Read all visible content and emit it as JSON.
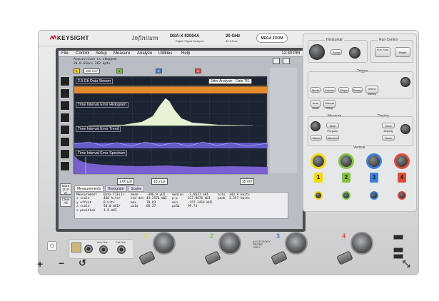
{
  "header": {
    "brand": "KEYSIGHT",
    "family": "Infiniium",
    "model": "DSA-X 92004A",
    "model_sub": "Digital Signal Analyzer",
    "bandwidth": "20 GHz",
    "sample_rate": "80 GSa/s",
    "badge": "MEGA ZOOM"
  },
  "screen": {
    "menu": [
      "File",
      "Control",
      "Setup",
      "Measure",
      "Analyze",
      "Utilities",
      "Help"
    ],
    "clock": "12:30 PM",
    "status_lines": [
      "Acquisition is stopped.",
      "20.0 GSa/s   262 kpts"
    ],
    "channel_scale": "200 mV/",
    "trace_labels": [
      "2.5 Gb Data Stream",
      "Time Interval Error Histogram",
      "Time Interval Error Trend",
      "Time Interval Error Spectrum"
    ],
    "jitter_label": "Jitter Analysis - Data TIE",
    "timebase_scale": "1.00 µs/",
    "timebase_delay": "18.2 µs",
    "trigger_level": "35 mV",
    "tabs": [
      "Measurements",
      "Histogram",
      "Scales"
    ],
    "more_label": "More (2 of 2)",
    "clear_label": "Clear All",
    "measurements": [
      [
        "Measurement",
        "Data TIE(1)",
        "mean",
        "-396.9 µUI",
        "median",
        "-1.8637 mUI",
        "hits",
        "343.9 kbits"
      ],
      [
        "x scale",
        "460 hits/",
        "std dev",
        "43.2576 mUI",
        "p-p",
        "317.9676 mUI",
        "peak",
        "3.357 kbits"
      ],
      [
        "y offset",
        "0 hits",
        "max",
        "78.83",
        "min",
        "-157.2414 mUI",
        "",
        ""
      ],
      [
        "x scale",
        "50.0 mUI/",
        "μ±1σ",
        "68.27",
        "μ±3σ",
        "99.73",
        "",
        ""
      ],
      [
        "x position",
        "1.0 mUI",
        "",
        "",
        "",
        "",
        "",
        ""
      ]
    ]
  },
  "panel": {
    "horizontal": "Horizontal",
    "run_control": "Run Control",
    "zoom": "Zoom",
    "run_stop": "Run Stop",
    "single": "Single",
    "trigger": "Trigger",
    "trigger_buttons": [
      "Mode",
      "Source",
      "Slope",
      "Sweep",
      "Select Sweep"
    ],
    "auto_scale": "Auto Scale",
    "default_setup": "Default Setup",
    "measure": "Measure",
    "display": "Display",
    "marker": "Marker",
    "measure_buttons": [
      "Position",
      "Multi Purpose",
      "Markers",
      "Touch",
      "Intensity",
      "Clear Display",
      "Select"
    ],
    "vertical": "Vertical",
    "channels": [
      "1",
      "2",
      "3",
      "4"
    ]
  },
  "bottom": {
    "aux_out": "Aux Out",
    "cal_out": "Cal Out",
    "inputs": [
      "1",
      "2",
      "3",
      "4"
    ],
    "warning": "ACCESSORY PROBE ONLY"
  },
  "colors": {
    "ch1": "#f5d90a",
    "ch2": "#7fc241",
    "ch3": "#3f7fd6",
    "ch4": "#e24b3a",
    "wave_bg": "#1c2333",
    "data_stream": "#e38a2b",
    "histogram": "#e8f3d6",
    "trend": "#6e63d8",
    "spectrum": "#7a5fd0"
  },
  "icons": {
    "brand_mark": "keysight-wave-icon",
    "power": "power-icon",
    "zoom_in": "plus-icon",
    "zoom_out": "minus-icon",
    "reset": "reset-icon",
    "expand": "expand-icon"
  }
}
